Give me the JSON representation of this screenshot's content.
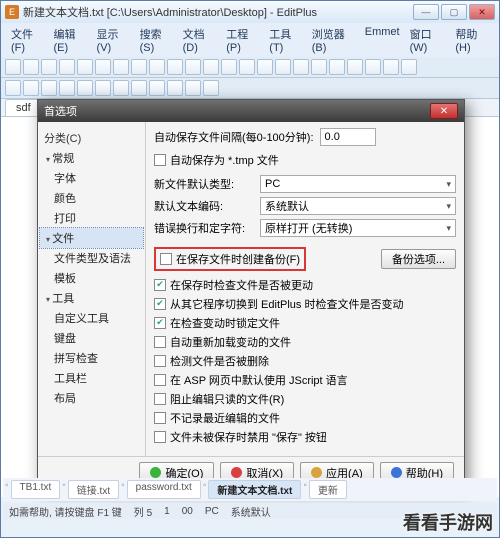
{
  "window": {
    "title": "新建文本文档.txt [C:\\Users\\Administrator\\Desktop] - EditPlus"
  },
  "menu": {
    "file": "文件(F)",
    "edit": "编辑(E)",
    "view": "显示(V)",
    "search": "搜索(S)",
    "doc": "文档(D)",
    "project": "工程(P)",
    "tools": "工具(T)",
    "browser": "浏览器(B)",
    "emmet": "Emmet",
    "window": "窗口(W)",
    "help": "帮助(H)"
  },
  "tabs": {
    "active": "sdf"
  },
  "dialog": {
    "title": "首选项",
    "category_label": "分类(C)",
    "tree": {
      "general": "常规",
      "font": "字体",
      "colors": "颜色",
      "print": "打印",
      "file": "文件",
      "filetypes": "文件类型及语法",
      "templates": "模板",
      "tools": "工具",
      "usertools": "自定义工具",
      "keyboard": "键盘",
      "spell": "拼写检查",
      "toolbar": "工具栏",
      "layout": "布局"
    },
    "right": {
      "autosave_label": "自动保存文件间隔(每0-100分钟):",
      "autosave_value": "0.0",
      "autosave_tmp": "自动保存为 *.tmp 文件",
      "newfile_type_label": "新文件默认类型:",
      "newfile_type_value": "PC",
      "default_encoding_label": "默认文本编码:",
      "default_encoding_value": "系统默认",
      "wrap_label": "错误换行和定字符:",
      "wrap_value": "原样打开 (无转换)",
      "backup_on_save": "在保存文件时创建备份(F)",
      "backup_options_btn": "备份选项...",
      "check_modified": "在保存时检查文件是否被更动",
      "check_switch": "从其它程序切换到 EditPlus 时检查文件是否变动",
      "check_lock": "在检查变动时锁定文件",
      "auto_reload": "自动重新加载变动的文件",
      "detect_deleted": "检测文件是否被删除",
      "asp_jscript": "在 ASP 网页中默认使用 JScript 语言",
      "block_readonly": "阻止编辑只读的文件(R)",
      "no_remember_recent": "不记录最近编辑的文件",
      "no_remember_files": "文件未被保存时禁用 \"保存\" 按钮"
    },
    "buttons": {
      "ok": "确定(O)",
      "cancel": "取消(X)",
      "apply": "应用(A)",
      "help": "帮助(H)"
    }
  },
  "footer_tabs": {
    "t1": "TB1.txt",
    "t2": "链接.txt",
    "t3": "password.txt",
    "t4": "新建文本文档.txt",
    "t5": "更新"
  },
  "status": {
    "hint": "如需帮助, 请按键盘 F1 键",
    "line": "列 5",
    "col": "1",
    "total": "00",
    "enc": "PC",
    "sys": "系统默认"
  },
  "watermark": "看看手游网"
}
